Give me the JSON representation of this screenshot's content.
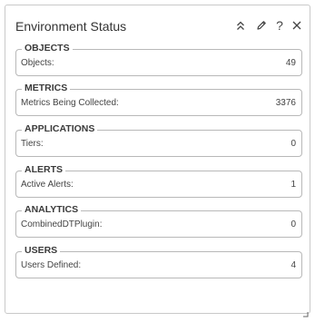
{
  "widget": {
    "title": "Environment Status",
    "toolbar": {
      "collapse_icon": "double-chevron-up-icon",
      "edit_icon": "pencil-icon",
      "help_label": "?",
      "close_icon": "close-x-icon"
    }
  },
  "sections": [
    {
      "title": "OBJECTS",
      "label": "Objects:",
      "value": "49"
    },
    {
      "title": "METRICS",
      "label": "Metrics Being Collected:",
      "value": "3376"
    },
    {
      "title": "APPLICATIONS",
      "label": "Tiers:",
      "value": "0"
    },
    {
      "title": "ALERTS",
      "label": "Active Alerts:",
      "value": "1"
    },
    {
      "title": "ANALYTICS",
      "label": "CombinedDTPlugin:",
      "value": "0"
    },
    {
      "title": "USERS",
      "label": "Users Defined:",
      "value": "4"
    }
  ],
  "colors": {
    "border": "#c9c9c9",
    "section_border": "#b8b8b8",
    "text": "#333333",
    "icon": "#444444"
  }
}
